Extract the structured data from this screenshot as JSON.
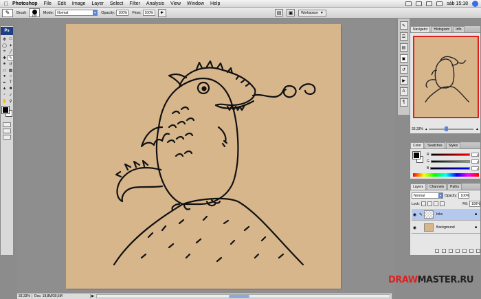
{
  "menubar": {
    "apple": "",
    "app_name": "Photoshop",
    "items": [
      "File",
      "Edit",
      "Image",
      "Layer",
      "Select",
      "Filter",
      "Analysis",
      "View",
      "Window",
      "Help"
    ],
    "clock": "sáb 15:18"
  },
  "options_bar": {
    "brush_label": "Brush:",
    "brush_size": "100",
    "mode_label": "Mode:",
    "mode_value": "Normal",
    "opacity_label": "Opacity:",
    "opacity_value": "100%",
    "flow_label": "Flow:",
    "flow_value": "100%",
    "workspace_label": "Workspace"
  },
  "tools": {
    "logo": "Ps"
  },
  "navigator": {
    "tabs": [
      "Navigator",
      "Histogram",
      "Info"
    ],
    "zoom": "33,33%"
  },
  "color_panel": {
    "tabs": [
      "Color",
      "Swatches",
      "Styles"
    ],
    "channels": [
      {
        "label": "R",
        "value": "0",
        "gradient": "#ff0000"
      },
      {
        "label": "G",
        "value": "0",
        "gradient": "#00ff00"
      },
      {
        "label": "B",
        "value": "0",
        "gradient": "#0000ff"
      }
    ]
  },
  "layers_panel": {
    "tabs": [
      "Layers",
      "Channels",
      "Paths"
    ],
    "blend_mode": "Normal",
    "opacity_label": "Opacity:",
    "opacity_value": "100%",
    "lock_label": "Lock:",
    "fill_label": "Fill:",
    "fill_value": "100%",
    "layers": [
      {
        "name": "Inks",
        "selected": true,
        "thumb": "checker"
      },
      {
        "name": "Background",
        "selected": false,
        "thumb": "tan"
      }
    ]
  },
  "status_bar": {
    "zoom": "33,33%",
    "doc_info": "Doc: 18,8M/30,5M"
  },
  "watermark": {
    "part1": "DRAW",
    "part2": "MASTER.RU"
  },
  "colors": {
    "canvas": "#d7b68c",
    "pasteboard": "#8e8e8e",
    "accent": "#5b85d6",
    "navigator_frame": "#e02020"
  }
}
